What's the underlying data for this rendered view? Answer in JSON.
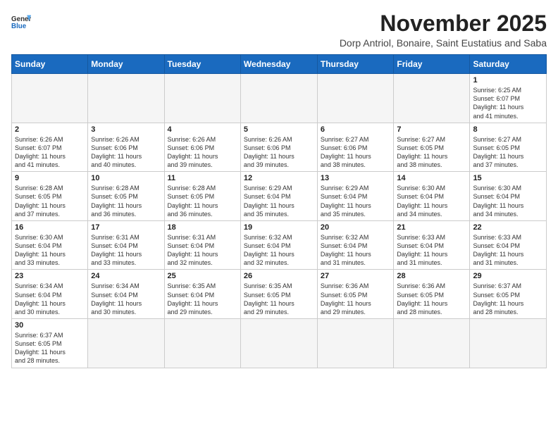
{
  "header": {
    "logo_general": "General",
    "logo_blue": "Blue",
    "month_title": "November 2025",
    "location": "Dorp Antriol, Bonaire, Saint Eustatius and Saba"
  },
  "weekdays": [
    "Sunday",
    "Monday",
    "Tuesday",
    "Wednesday",
    "Thursday",
    "Friday",
    "Saturday"
  ],
  "weeks": [
    [
      {
        "day": "",
        "info": ""
      },
      {
        "day": "",
        "info": ""
      },
      {
        "day": "",
        "info": ""
      },
      {
        "day": "",
        "info": ""
      },
      {
        "day": "",
        "info": ""
      },
      {
        "day": "",
        "info": ""
      },
      {
        "day": "1",
        "info": "Sunrise: 6:25 AM\nSunset: 6:07 PM\nDaylight: 11 hours\nand 41 minutes."
      }
    ],
    [
      {
        "day": "2",
        "info": "Sunrise: 6:26 AM\nSunset: 6:07 PM\nDaylight: 11 hours\nand 41 minutes."
      },
      {
        "day": "3",
        "info": "Sunrise: 6:26 AM\nSunset: 6:06 PM\nDaylight: 11 hours\nand 40 minutes."
      },
      {
        "day": "4",
        "info": "Sunrise: 6:26 AM\nSunset: 6:06 PM\nDaylight: 11 hours\nand 39 minutes."
      },
      {
        "day": "5",
        "info": "Sunrise: 6:26 AM\nSunset: 6:06 PM\nDaylight: 11 hours\nand 39 minutes."
      },
      {
        "day": "6",
        "info": "Sunrise: 6:27 AM\nSunset: 6:06 PM\nDaylight: 11 hours\nand 38 minutes."
      },
      {
        "day": "7",
        "info": "Sunrise: 6:27 AM\nSunset: 6:05 PM\nDaylight: 11 hours\nand 38 minutes."
      },
      {
        "day": "8",
        "info": "Sunrise: 6:27 AM\nSunset: 6:05 PM\nDaylight: 11 hours\nand 37 minutes."
      }
    ],
    [
      {
        "day": "9",
        "info": "Sunrise: 6:28 AM\nSunset: 6:05 PM\nDaylight: 11 hours\nand 37 minutes."
      },
      {
        "day": "10",
        "info": "Sunrise: 6:28 AM\nSunset: 6:05 PM\nDaylight: 11 hours\nand 36 minutes."
      },
      {
        "day": "11",
        "info": "Sunrise: 6:28 AM\nSunset: 6:05 PM\nDaylight: 11 hours\nand 36 minutes."
      },
      {
        "day": "12",
        "info": "Sunrise: 6:29 AM\nSunset: 6:04 PM\nDaylight: 11 hours\nand 35 minutes."
      },
      {
        "day": "13",
        "info": "Sunrise: 6:29 AM\nSunset: 6:04 PM\nDaylight: 11 hours\nand 35 minutes."
      },
      {
        "day": "14",
        "info": "Sunrise: 6:30 AM\nSunset: 6:04 PM\nDaylight: 11 hours\nand 34 minutes."
      },
      {
        "day": "15",
        "info": "Sunrise: 6:30 AM\nSunset: 6:04 PM\nDaylight: 11 hours\nand 34 minutes."
      }
    ],
    [
      {
        "day": "16",
        "info": "Sunrise: 6:30 AM\nSunset: 6:04 PM\nDaylight: 11 hours\nand 33 minutes."
      },
      {
        "day": "17",
        "info": "Sunrise: 6:31 AM\nSunset: 6:04 PM\nDaylight: 11 hours\nand 33 minutes."
      },
      {
        "day": "18",
        "info": "Sunrise: 6:31 AM\nSunset: 6:04 PM\nDaylight: 11 hours\nand 32 minutes."
      },
      {
        "day": "19",
        "info": "Sunrise: 6:32 AM\nSunset: 6:04 PM\nDaylight: 11 hours\nand 32 minutes."
      },
      {
        "day": "20",
        "info": "Sunrise: 6:32 AM\nSunset: 6:04 PM\nDaylight: 11 hours\nand 31 minutes."
      },
      {
        "day": "21",
        "info": "Sunrise: 6:33 AM\nSunset: 6:04 PM\nDaylight: 11 hours\nand 31 minutes."
      },
      {
        "day": "22",
        "info": "Sunrise: 6:33 AM\nSunset: 6:04 PM\nDaylight: 11 hours\nand 31 minutes."
      }
    ],
    [
      {
        "day": "23",
        "info": "Sunrise: 6:34 AM\nSunset: 6:04 PM\nDaylight: 11 hours\nand 30 minutes."
      },
      {
        "day": "24",
        "info": "Sunrise: 6:34 AM\nSunset: 6:04 PM\nDaylight: 11 hours\nand 30 minutes."
      },
      {
        "day": "25",
        "info": "Sunrise: 6:35 AM\nSunset: 6:04 PM\nDaylight: 11 hours\nand 29 minutes."
      },
      {
        "day": "26",
        "info": "Sunrise: 6:35 AM\nSunset: 6:05 PM\nDaylight: 11 hours\nand 29 minutes."
      },
      {
        "day": "27",
        "info": "Sunrise: 6:36 AM\nSunset: 6:05 PM\nDaylight: 11 hours\nand 29 minutes."
      },
      {
        "day": "28",
        "info": "Sunrise: 6:36 AM\nSunset: 6:05 PM\nDaylight: 11 hours\nand 28 minutes."
      },
      {
        "day": "29",
        "info": "Sunrise: 6:37 AM\nSunset: 6:05 PM\nDaylight: 11 hours\nand 28 minutes."
      }
    ],
    [
      {
        "day": "30",
        "info": "Sunrise: 6:37 AM\nSunset: 6:05 PM\nDaylight: 11 hours\nand 28 minutes."
      },
      {
        "day": "",
        "info": ""
      },
      {
        "day": "",
        "info": ""
      },
      {
        "day": "",
        "info": ""
      },
      {
        "day": "",
        "info": ""
      },
      {
        "day": "",
        "info": ""
      },
      {
        "day": "",
        "info": ""
      }
    ]
  ]
}
